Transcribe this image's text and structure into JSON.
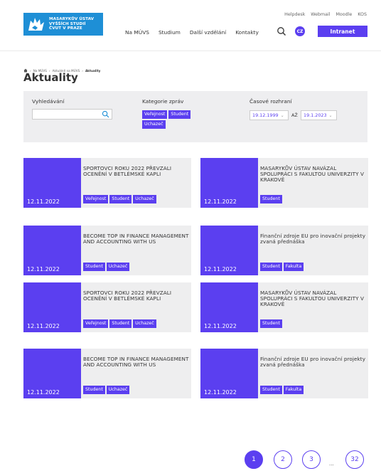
{
  "header": {
    "logo_lines": [
      "MASARYKŮV ÚSTAV",
      "VYŠŠÍCH STUDIÍ",
      "ČVUT V PRAZE"
    ],
    "utility": [
      "Helpdesk",
      "Webmail",
      "Moodle",
      "KOS"
    ],
    "nav": [
      "Na MÚVS",
      "Studium",
      "Další vzdělání",
      "Kontakty"
    ],
    "lang": "CZ",
    "intranet": "Intranet"
  },
  "breadcrumb": [
    "Na MÚVS",
    "Aktuálně na MÚVS",
    "Aktuality"
  ],
  "page_title": "Aktuality",
  "filters": {
    "search_label": "Vyhledávání",
    "search_value": "",
    "category_label": "Kategorie zpráv",
    "categories": [
      "Veřejnost",
      "Student",
      "Uchazeč"
    ],
    "time_label": "Časové rozhraní",
    "date_from": "19.12.1999",
    "separator": "AŽ",
    "date_to": "19.1.2023"
  },
  "cards": [
    {
      "date": "12.11.2022",
      "title": "SPORTOVCI ROKU 2022 PŘEVZALI OCENĚNÍ v BETLÉMSKÉ KAPLI",
      "tags": [
        "Veřejnost",
        "Student",
        "Uchazeč"
      ]
    },
    {
      "date": "12.11.2022",
      "title": "MASARYKŮV ÚSTAV NAVÁZAL SPOLUPRÁCI S FAKULTOU UNIVERZITY V KRAKOVĚ",
      "tags": [
        "Student"
      ]
    },
    {
      "date": "12.11.2022",
      "title": "BECOME TOP IN FINANCE MANAGEMENT AND ACCOUNTING WITH US",
      "tags": [
        "Student",
        "Uchazeč"
      ]
    },
    {
      "date": "12.11.2022",
      "title": "Finanční zdroje EU pro inovační projekty zvaná přednáška",
      "tags": [
        "Student",
        "Fakulta"
      ]
    },
    {
      "date": "12.11.2022",
      "title": "SPORTOVCI ROKU 2022 PŘEVZALI OCENĚNÍ v BETLÉMSKÉ KAPLI",
      "tags": [
        "Veřejnost",
        "Student",
        "Uchazeč"
      ]
    },
    {
      "date": "12.11.2022",
      "title": "MASARYKŮV ÚSTAV NAVÁZAL SPOLUPRÁCI S FAKULTOU UNIVERZITY V KRAKOVĚ",
      "tags": [
        "Student"
      ]
    },
    {
      "date": "12.11.2022",
      "title": "BECOME TOP IN FINANCE MANAGEMENT AND ACCOUNTING WITH US",
      "tags": [
        "Student",
        "Uchazeč"
      ]
    },
    {
      "date": "12.11.2022",
      "title": "Finanční zdroje EU pro inovační projekty zvaná přednáška",
      "tags": [
        "Student",
        "Fakulta"
      ]
    }
  ],
  "pagination": {
    "pages": [
      "1",
      "2",
      "3"
    ],
    "ellipsis": "...",
    "last": "32",
    "current": "1"
  },
  "colors": {
    "accent": "#5b3ff0",
    "logo_blue": "#1e8fd6",
    "card_bg": "#eeeeef"
  }
}
